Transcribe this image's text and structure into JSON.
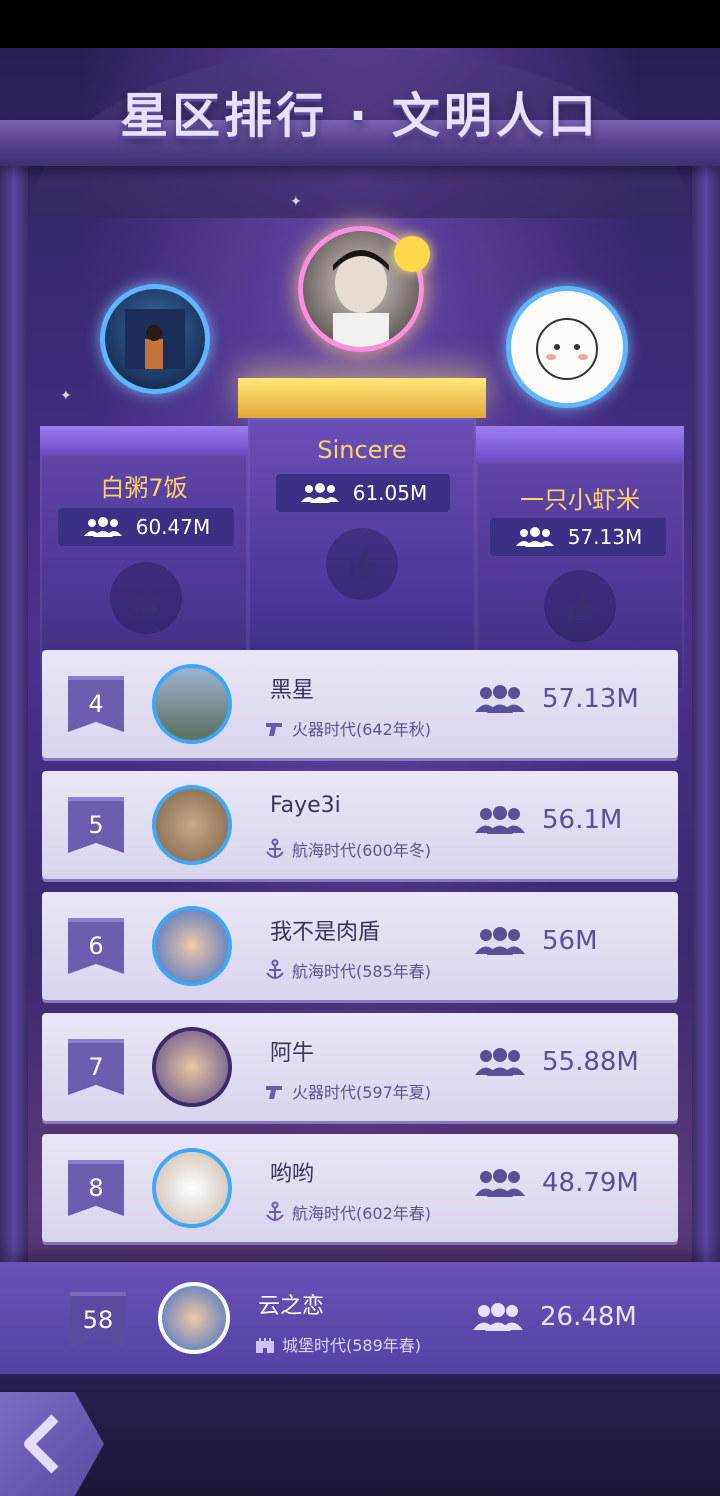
{
  "title": "星区排行 · 文明人口",
  "podium": [
    {
      "rank": 2,
      "name": "白粥7饭",
      "population": "60.47M"
    },
    {
      "rank": 1,
      "name": "Sincere",
      "population": "61.05M"
    },
    {
      "rank": 3,
      "name": "一只小虾米",
      "population": "57.13M"
    }
  ],
  "list": [
    {
      "rank": "4",
      "name": "黑星",
      "era": "火器时代(642年秋)",
      "era_icon": "gun-icon",
      "population": "57.13M"
    },
    {
      "rank": "5",
      "name": "Faye3i",
      "era": "航海时代(600年冬)",
      "era_icon": "anchor-icon",
      "population": "56.1M"
    },
    {
      "rank": "6",
      "name": "我不是肉盾",
      "era": "航海时代(585年春)",
      "era_icon": "anchor-icon",
      "population": "56M"
    },
    {
      "rank": "7",
      "name": "阿牛",
      "era": "火器时代(597年夏)",
      "era_icon": "gun-icon",
      "population": "55.88M"
    },
    {
      "rank": "8",
      "name": "哟哟",
      "era": "航海时代(602年春)",
      "era_icon": "anchor-icon",
      "population": "48.79M"
    }
  ],
  "self": {
    "rank": "58",
    "name": "云之恋",
    "era": "城堡时代(589年春)",
    "era_icon": "castle-icon",
    "population": "26.48M"
  },
  "colors": {
    "accent_gold": "#ffd36a",
    "pill_bg": "#3c2f86",
    "row_bg": "#e4e0f3",
    "rank_ribbon": "#6e5cae"
  }
}
